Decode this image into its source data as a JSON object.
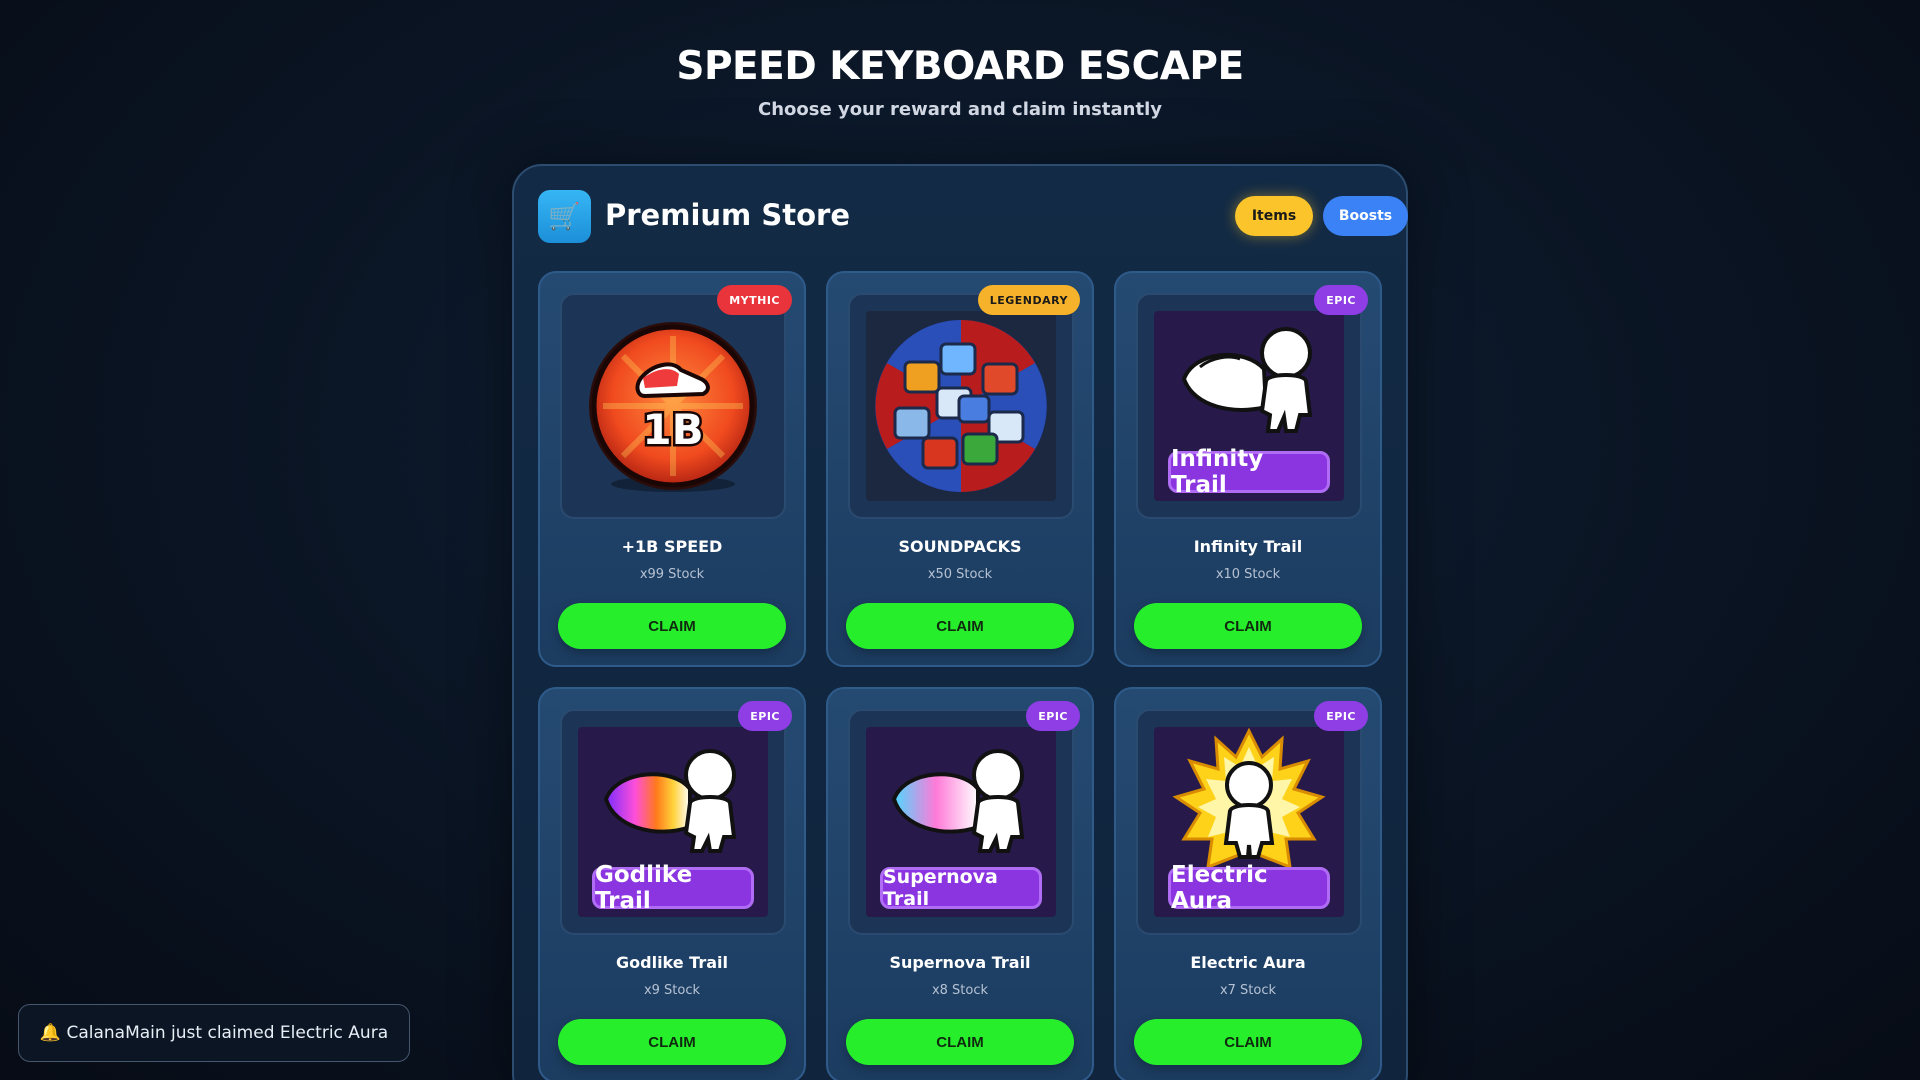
{
  "page": {
    "title": "SPEED KEYBOARD ESCAPE",
    "subtitle": "Choose your reward and claim instantly"
  },
  "store": {
    "title": "Premium Store",
    "icon": "shopping-cart-icon",
    "tabs": [
      {
        "label": "Items",
        "active": true,
        "color": "#fbc42a"
      },
      {
        "label": "Boosts",
        "active": false,
        "color": "#3b82f6"
      }
    ]
  },
  "items": [
    {
      "name": "+1B SPEED",
      "stock": "x99 Stock",
      "rarity": "MYTHIC",
      "rarity_color": "#e8343a",
      "claim_label": "CLAIM",
      "image": "speed-shoe-coin-icon",
      "image_text": "1B"
    },
    {
      "name": "SOUNDPACKS",
      "stock": "x50 Stock",
      "rarity": "LEGENDARY",
      "rarity_color": "#f6b22a",
      "claim_label": "CLAIM",
      "image": "keycap-wheel-icon"
    },
    {
      "name": "Infinity Trail",
      "stock": "x10 Stock",
      "rarity": "EPIC",
      "rarity_color": "#8f3ee6",
      "claim_label": "CLAIM",
      "image": "infinity-trail-icon",
      "image_text": "Infinity Trail"
    },
    {
      "name": "Godlike Trail",
      "stock": "x9 Stock",
      "rarity": "EPIC",
      "rarity_color": "#8f3ee6",
      "claim_label": "CLAIM",
      "image": "godlike-trail-icon",
      "image_text": "Godlike Trail"
    },
    {
      "name": "Supernova Trail",
      "stock": "x8 Stock",
      "rarity": "EPIC",
      "rarity_color": "#8f3ee6",
      "claim_label": "CLAIM",
      "image": "supernova-trail-icon",
      "image_text": "Supernova Trail"
    },
    {
      "name": "Electric Aura",
      "stock": "x7 Stock",
      "rarity": "EPIC",
      "rarity_color": "#8f3ee6",
      "claim_label": "CLAIM",
      "image": "electric-aura-icon",
      "image_text": "Electric Aura"
    }
  ],
  "notification": {
    "icon": "bell-icon",
    "text": "🔔 CalanaMain just claimed Electric Aura"
  }
}
